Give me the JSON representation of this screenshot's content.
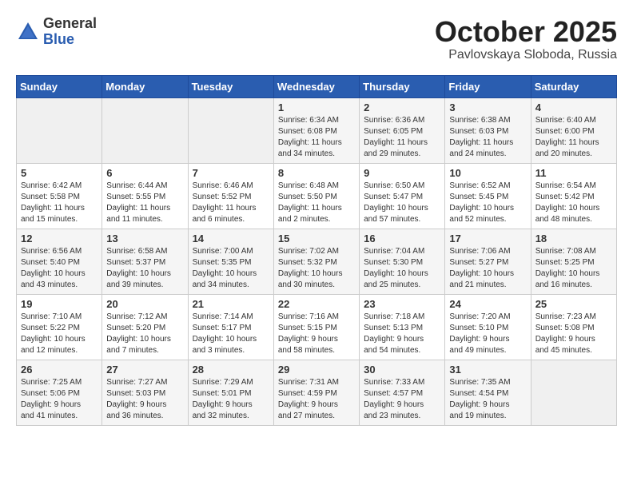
{
  "header": {
    "logo_general": "General",
    "logo_blue": "Blue",
    "month_title": "October 2025",
    "location": "Pavlovskaya Sloboda, Russia"
  },
  "calendar": {
    "days_of_week": [
      "Sunday",
      "Monday",
      "Tuesday",
      "Wednesday",
      "Thursday",
      "Friday",
      "Saturday"
    ],
    "weeks": [
      [
        {
          "day": "",
          "info": ""
        },
        {
          "day": "",
          "info": ""
        },
        {
          "day": "",
          "info": ""
        },
        {
          "day": "1",
          "info": "Sunrise: 6:34 AM\nSunset: 6:08 PM\nDaylight: 11 hours\nand 34 minutes."
        },
        {
          "day": "2",
          "info": "Sunrise: 6:36 AM\nSunset: 6:05 PM\nDaylight: 11 hours\nand 29 minutes."
        },
        {
          "day": "3",
          "info": "Sunrise: 6:38 AM\nSunset: 6:03 PM\nDaylight: 11 hours\nand 24 minutes."
        },
        {
          "day": "4",
          "info": "Sunrise: 6:40 AM\nSunset: 6:00 PM\nDaylight: 11 hours\nand 20 minutes."
        }
      ],
      [
        {
          "day": "5",
          "info": "Sunrise: 6:42 AM\nSunset: 5:58 PM\nDaylight: 11 hours\nand 15 minutes."
        },
        {
          "day": "6",
          "info": "Sunrise: 6:44 AM\nSunset: 5:55 PM\nDaylight: 11 hours\nand 11 minutes."
        },
        {
          "day": "7",
          "info": "Sunrise: 6:46 AM\nSunset: 5:52 PM\nDaylight: 11 hours\nand 6 minutes."
        },
        {
          "day": "8",
          "info": "Sunrise: 6:48 AM\nSunset: 5:50 PM\nDaylight: 11 hours\nand 2 minutes."
        },
        {
          "day": "9",
          "info": "Sunrise: 6:50 AM\nSunset: 5:47 PM\nDaylight: 10 hours\nand 57 minutes."
        },
        {
          "day": "10",
          "info": "Sunrise: 6:52 AM\nSunset: 5:45 PM\nDaylight: 10 hours\nand 52 minutes."
        },
        {
          "day": "11",
          "info": "Sunrise: 6:54 AM\nSunset: 5:42 PM\nDaylight: 10 hours\nand 48 minutes."
        }
      ],
      [
        {
          "day": "12",
          "info": "Sunrise: 6:56 AM\nSunset: 5:40 PM\nDaylight: 10 hours\nand 43 minutes."
        },
        {
          "day": "13",
          "info": "Sunrise: 6:58 AM\nSunset: 5:37 PM\nDaylight: 10 hours\nand 39 minutes."
        },
        {
          "day": "14",
          "info": "Sunrise: 7:00 AM\nSunset: 5:35 PM\nDaylight: 10 hours\nand 34 minutes."
        },
        {
          "day": "15",
          "info": "Sunrise: 7:02 AM\nSunset: 5:32 PM\nDaylight: 10 hours\nand 30 minutes."
        },
        {
          "day": "16",
          "info": "Sunrise: 7:04 AM\nSunset: 5:30 PM\nDaylight: 10 hours\nand 25 minutes."
        },
        {
          "day": "17",
          "info": "Sunrise: 7:06 AM\nSunset: 5:27 PM\nDaylight: 10 hours\nand 21 minutes."
        },
        {
          "day": "18",
          "info": "Sunrise: 7:08 AM\nSunset: 5:25 PM\nDaylight: 10 hours\nand 16 minutes."
        }
      ],
      [
        {
          "day": "19",
          "info": "Sunrise: 7:10 AM\nSunset: 5:22 PM\nDaylight: 10 hours\nand 12 minutes."
        },
        {
          "day": "20",
          "info": "Sunrise: 7:12 AM\nSunset: 5:20 PM\nDaylight: 10 hours\nand 7 minutes."
        },
        {
          "day": "21",
          "info": "Sunrise: 7:14 AM\nSunset: 5:17 PM\nDaylight: 10 hours\nand 3 minutes."
        },
        {
          "day": "22",
          "info": "Sunrise: 7:16 AM\nSunset: 5:15 PM\nDaylight: 9 hours\nand 58 minutes."
        },
        {
          "day": "23",
          "info": "Sunrise: 7:18 AM\nSunset: 5:13 PM\nDaylight: 9 hours\nand 54 minutes."
        },
        {
          "day": "24",
          "info": "Sunrise: 7:20 AM\nSunset: 5:10 PM\nDaylight: 9 hours\nand 49 minutes."
        },
        {
          "day": "25",
          "info": "Sunrise: 7:23 AM\nSunset: 5:08 PM\nDaylight: 9 hours\nand 45 minutes."
        }
      ],
      [
        {
          "day": "26",
          "info": "Sunrise: 7:25 AM\nSunset: 5:06 PM\nDaylight: 9 hours\nand 41 minutes."
        },
        {
          "day": "27",
          "info": "Sunrise: 7:27 AM\nSunset: 5:03 PM\nDaylight: 9 hours\nand 36 minutes."
        },
        {
          "day": "28",
          "info": "Sunrise: 7:29 AM\nSunset: 5:01 PM\nDaylight: 9 hours\nand 32 minutes."
        },
        {
          "day": "29",
          "info": "Sunrise: 7:31 AM\nSunset: 4:59 PM\nDaylight: 9 hours\nand 27 minutes."
        },
        {
          "day": "30",
          "info": "Sunrise: 7:33 AM\nSunset: 4:57 PM\nDaylight: 9 hours\nand 23 minutes."
        },
        {
          "day": "31",
          "info": "Sunrise: 7:35 AM\nSunset: 4:54 PM\nDaylight: 9 hours\nand 19 minutes."
        },
        {
          "day": "",
          "info": ""
        }
      ]
    ]
  }
}
